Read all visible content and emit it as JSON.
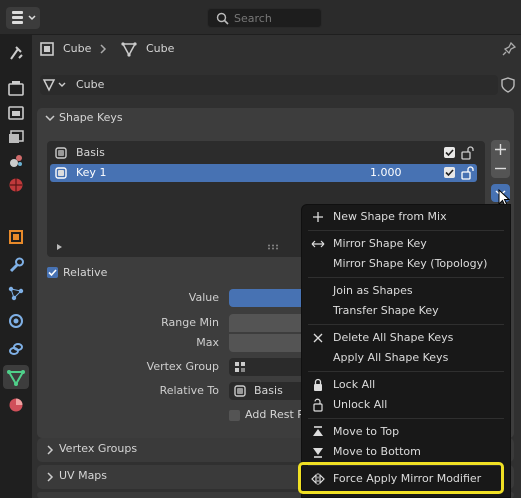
{
  "header": {
    "search_placeholder": "Search"
  },
  "context": {
    "object_name": "Cube",
    "mesh_name": "Cube",
    "datablock_name": "Cube"
  },
  "shape_keys": {
    "panel_title": "Shape Keys",
    "items": [
      {
        "name": "Basis",
        "value": ""
      },
      {
        "name": "Key 1",
        "value": "1.000"
      }
    ],
    "relative_label": "Relative",
    "relative_checked": true,
    "value_label": "Value",
    "range_min_label": "Range Min",
    "max_label": "Max",
    "vertex_group_label": "Vertex Group",
    "relative_to_label": "Relative To",
    "relative_to_value": "Basis",
    "add_rest_label": "Add Rest P"
  },
  "subpanels": {
    "vertex_groups": "Vertex Groups",
    "uv_maps": "UV Maps"
  },
  "menu": {
    "items": [
      {
        "label": "New Shape from Mix",
        "icon": "plus-icon"
      },
      {
        "label": "Mirror Shape Key",
        "icon": "arrows-horizontal-icon"
      },
      {
        "label": "Mirror Shape Key (Topology)",
        "icon": ""
      },
      {
        "label": "Join as Shapes",
        "icon": ""
      },
      {
        "label": "Transfer Shape Key",
        "icon": ""
      },
      {
        "label": "Delete All Shape Keys",
        "icon": "x-icon"
      },
      {
        "label": "Apply All Shape Keys",
        "icon": ""
      },
      {
        "label": "Lock All",
        "icon": "lock-icon"
      },
      {
        "label": "Unlock All",
        "icon": "unlock-icon"
      },
      {
        "label": "Move to Top",
        "icon": "move-top-icon"
      },
      {
        "label": "Move to Bottom",
        "icon": "move-bottom-icon"
      },
      {
        "label": "Force Apply Mirror Modifier",
        "icon": "mirror-modifier-icon"
      }
    ]
  },
  "colors": {
    "selection_blue": "#4772b3",
    "highlight_yellow": "#f0e024"
  }
}
